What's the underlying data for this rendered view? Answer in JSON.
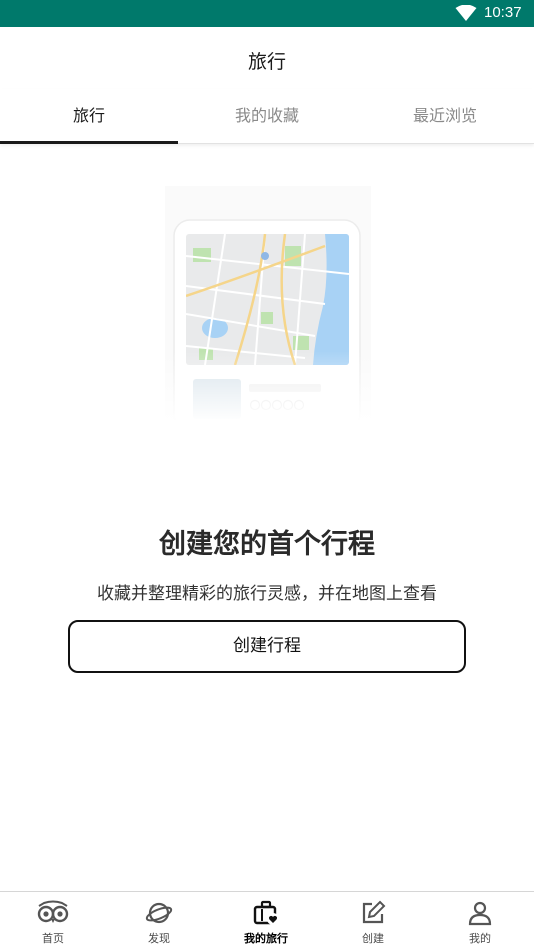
{
  "status_bar": {
    "time": "10:37"
  },
  "header": {
    "title": "旅行"
  },
  "tabs": [
    {
      "label": "旅行",
      "active": true
    },
    {
      "label": "我的收藏",
      "active": false
    },
    {
      "label": "最近浏览",
      "active": false
    }
  ],
  "empty_state": {
    "title": "创建您的首个行程",
    "subtitle": "收藏并整理精彩的旅行灵感，并在地图上查看",
    "button_label": "创建行程"
  },
  "bottom_nav": {
    "items": [
      {
        "label": "首页",
        "icon": "owl-icon",
        "active": false
      },
      {
        "label": "发现",
        "icon": "planet-icon",
        "active": false
      },
      {
        "label": "我的旅行",
        "icon": "suitcase-heart-icon",
        "active": true
      },
      {
        "label": "创建",
        "icon": "edit-icon",
        "active": false
      },
      {
        "label": "我的",
        "icon": "person-icon",
        "active": false
      }
    ]
  },
  "colors": {
    "status_bar": "#00796b",
    "text_primary": "#1a1a1a",
    "text_secondary": "#8a8a8a"
  }
}
